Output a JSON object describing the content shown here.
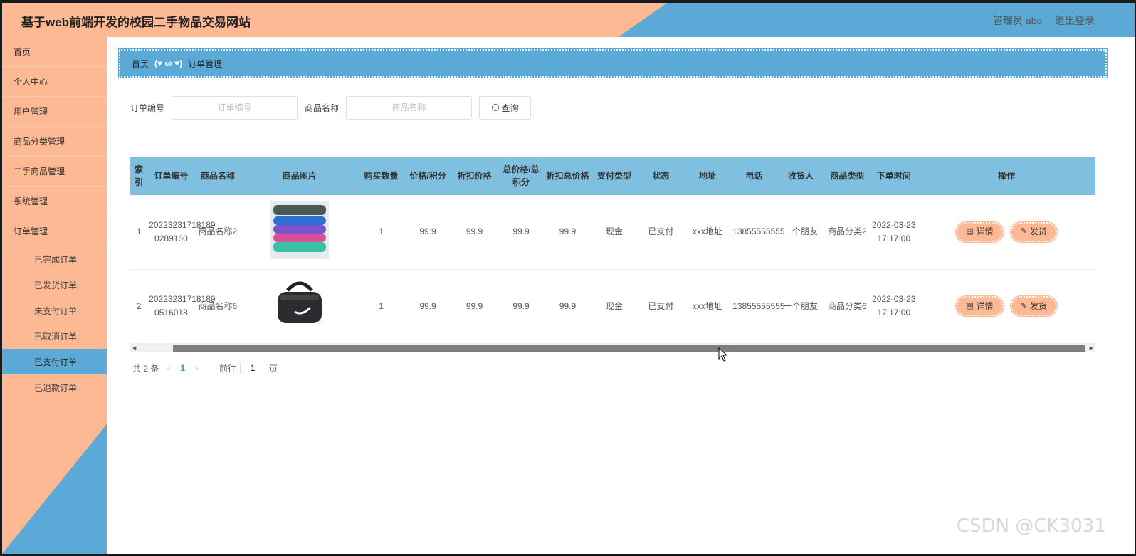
{
  "header": {
    "title": "基于web前端开发的校园二手物品交易网站",
    "admin": "管理员 abo",
    "logout": "退出登录"
  },
  "sidebar": {
    "items": [
      {
        "label": "首页",
        "expandable": false
      },
      {
        "label": "个人中心",
        "expandable": true
      },
      {
        "label": "用户管理",
        "expandable": true
      },
      {
        "label": "商品分类管理",
        "expandable": true
      },
      {
        "label": "二手商品管理",
        "expandable": true
      },
      {
        "label": "系统管理",
        "expandable": true
      },
      {
        "label": "订单管理",
        "expandable": true
      }
    ],
    "sub_items": [
      "已完成订单",
      "已发货订单",
      "未支付订单",
      "已取消订单",
      "已支付订单",
      "已退款订单"
    ],
    "active_sub": "已支付订单"
  },
  "breadcrumb": {
    "home": "首页",
    "separator": "(♥ ω ♥)",
    "current": "订单管理"
  },
  "search": {
    "order_label": "订单编号",
    "order_placeholder": "订单编号",
    "goods_label": "商品名称",
    "goods_placeholder": "商品名称",
    "button": "查询"
  },
  "table": {
    "columns": [
      "索引",
      "订单编号",
      "商品名称",
      "商品图片",
      "购买数量",
      "价格/积分",
      "折扣价格",
      "总价格/总积分",
      "折扣总价格",
      "支付类型",
      "状态",
      "地址",
      "电话",
      "收货人",
      "商品类型",
      "下单时间",
      "操作"
    ],
    "rows": [
      {
        "index": "1",
        "order_no": "20223231718189 0289160",
        "goods": "商品名称2",
        "image": "resistance-bands",
        "qty": "1",
        "price": "99.9",
        "discount": "99.9",
        "total": "99.9",
        "discount_total": "99.9",
        "pay_type": "现金",
        "status": "已支付",
        "address": "xxx地址",
        "phone": "13855555555",
        "receiver": "一个朋友",
        "category": "商品分类2",
        "time": "2022-03-23 17:17:00"
      },
      {
        "index": "2",
        "order_no": "20223231718189 0516018",
        "goods": "商品名称6",
        "image": "sports-duffel-bag",
        "qty": "1",
        "price": "99.9",
        "discount": "99.9",
        "total": "99.9",
        "discount_total": "99.9",
        "pay_type": "现金",
        "status": "已支付",
        "address": "xxx地址",
        "phone": "13855555555",
        "receiver": "一个朋友",
        "category": "商品分类6",
        "time": "2022-03-23 17:17:00"
      }
    ],
    "detail_button": "详情",
    "ship_button": "发货"
  },
  "pager": {
    "total": "共 2 条",
    "current": "1",
    "goto_label": "前往",
    "goto_value": "1",
    "page_suffix": "页"
  },
  "watermark": "CSDN @CK3031",
  "colors": {
    "peach": "#fdb894",
    "blue": "#5aa9d6",
    "header_blue": "#7fbfe0"
  }
}
